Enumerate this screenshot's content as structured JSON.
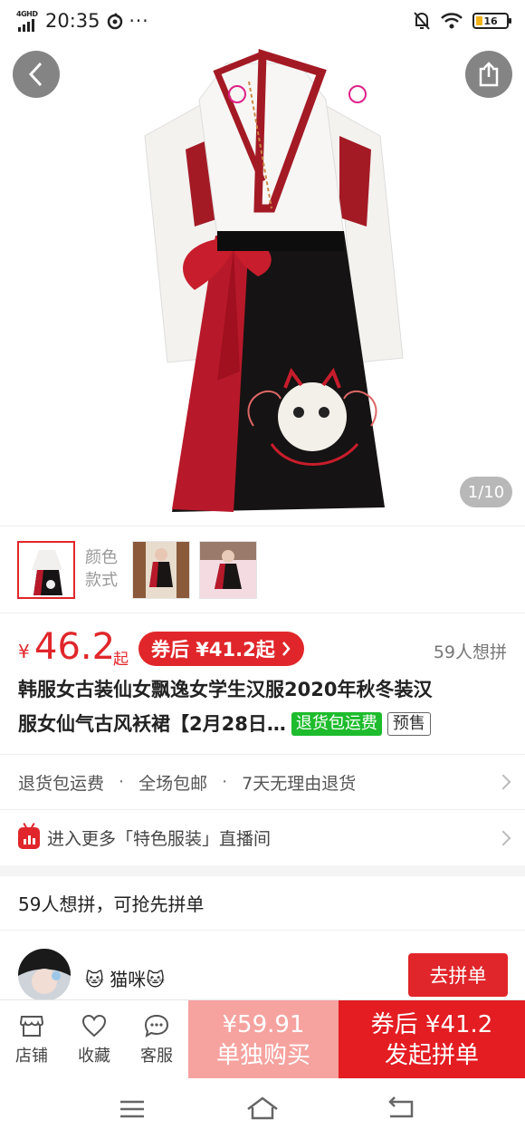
{
  "status_bar": {
    "network": "4GHD",
    "time": "20:35",
    "battery": "16"
  },
  "hero": {
    "page_indicator": "1/10"
  },
  "variants": {
    "label": "颜色款式"
  },
  "price": {
    "currency": "¥",
    "value": "46.2",
    "suffix": "起",
    "coupon": "券后 ¥41.2起",
    "want_count": "59人想拼"
  },
  "title": {
    "line1": "韩服女古装仙女飘逸女学生汉服2020年秋冬装汉",
    "line2": "服女仙气古风袄裙【2月28日…",
    "tag_return": "退货包运费",
    "tag_presale": "预售"
  },
  "services": {
    "item1": "退货包运费",
    "item2": "全场包邮",
    "item3": "7天无理由退货",
    "separator": "·"
  },
  "live": {
    "text": "进入更多「特色服装」直播间"
  },
  "group": {
    "header": "59人想拼，可抢先拼单",
    "user_name": "🐱 猫咪🐱",
    "join_label": "去拼单"
  },
  "action_bar": {
    "shop": "店铺",
    "favorite": "收藏",
    "service": "客服",
    "alone_price": "¥59.91",
    "alone_label": "单独购买",
    "group_price": "券后 ¥41.2",
    "group_label": "发起拼单"
  },
  "colors": {
    "accent": "#e0262a",
    "alone_bg": "#f6a3a0",
    "group_bg": "#e31d22",
    "tag_green": "#1ebc2d"
  },
  "icons": [
    "back-arrow-icon",
    "share-icon",
    "shop-icon",
    "heart-icon",
    "chat-icon",
    "menu-icon",
    "home-icon",
    "back-nav-icon",
    "live-tv-icon",
    "chevron-right-icon",
    "wifi-icon",
    "mute-bell-icon",
    "battery-icon",
    "signal-icon"
  ]
}
